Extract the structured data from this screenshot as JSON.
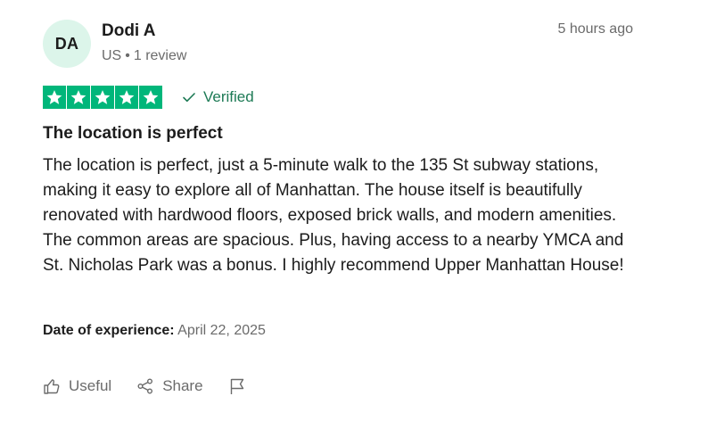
{
  "reviewer": {
    "initials": "DA",
    "name": "Dodi A",
    "country": "US",
    "review_count": "1 review"
  },
  "time_ago": "5 hours ago",
  "rating": {
    "stars": 5,
    "max": 5,
    "verified_label": "Verified",
    "star_color": "#00b67a"
  },
  "review": {
    "title": "The location is perfect",
    "body": "The location is perfect, just a 5-minute walk to the 135 St subway stations, making it easy to explore all of Manhattan. The house itself is beautifully renovated with hardwood floors, exposed brick walls, and modern amenities. The common areas are spacious. Plus, having access to a nearby YMCA and St. Nicholas Park was a bonus. I highly recommend Upper Manhattan House!"
  },
  "experience": {
    "label": "Date of experience:",
    "date": "April 22, 2025"
  },
  "actions": {
    "useful_label": "Useful",
    "share_label": "Share",
    "icons": [
      "thumbs-up-icon",
      "share-icon",
      "flag-icon"
    ]
  },
  "colors": {
    "avatar_bg": "#dcf5ea",
    "verified_text": "#1d7a55",
    "muted_text": "#6b6b6b"
  }
}
